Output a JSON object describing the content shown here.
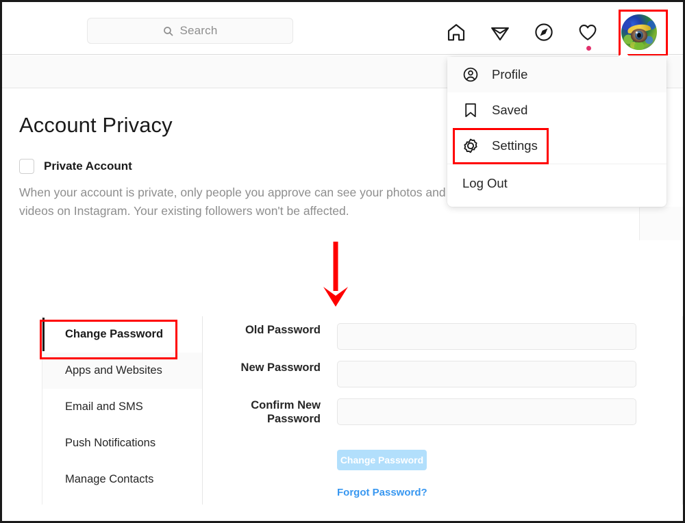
{
  "search": {
    "placeholder": "Search",
    "icon": "search-icon"
  },
  "nav": {
    "icons": [
      {
        "name": "home-icon",
        "label": "Home"
      },
      {
        "name": "direct-share-icon",
        "label": "Direct"
      },
      {
        "name": "explore-compass-icon",
        "label": "Explore"
      },
      {
        "name": "heart-activity-icon",
        "label": "Activity"
      }
    ],
    "avatar_label": "Profile avatar"
  },
  "dropdown": {
    "items": [
      {
        "label": "Profile",
        "icon": "person-circle-icon",
        "highlighted": true
      },
      {
        "label": "Saved",
        "icon": "bookmark-icon",
        "highlighted": false
      },
      {
        "label": "Settings",
        "icon": "gear-cog-icon",
        "highlighted": false
      }
    ],
    "logout_label": "Log Out"
  },
  "privacy": {
    "title": "Account Privacy",
    "checkbox_label": "Private Account",
    "checkbox_checked": false,
    "description": "When your account is private, only people you approve can see your photos and videos on Instagram. Your existing followers won't be affected."
  },
  "settings": {
    "sidebar_items": [
      {
        "label": "Change Password",
        "active": true,
        "hover": false
      },
      {
        "label": "Apps and Websites",
        "active": false,
        "hover": true
      },
      {
        "label": "Email and SMS",
        "active": false,
        "hover": false
      },
      {
        "label": "Push Notifications",
        "active": false,
        "hover": false
      },
      {
        "label": "Manage Contacts",
        "active": false,
        "hover": false
      }
    ],
    "form": {
      "old_password_label": "Old Password",
      "old_password_value": "",
      "new_password_label": "New Password",
      "new_password_value": "",
      "confirm_password_label": "Confirm New Password",
      "confirm_password_value": "",
      "submit_label": "Change Password",
      "forgot_label": "Forgot Password?"
    }
  },
  "annotations": {
    "highlight_color": "#ff0000",
    "boxes": [
      "avatar-highlight",
      "settings-menu-highlight",
      "change-password-highlight"
    ],
    "arrow": "down-arrow-annotation"
  },
  "colors": {
    "link": "#3897f0",
    "button": "#b2dffc",
    "muted_text": "#8e8e8e",
    "notification_dot": "#e1306c"
  }
}
